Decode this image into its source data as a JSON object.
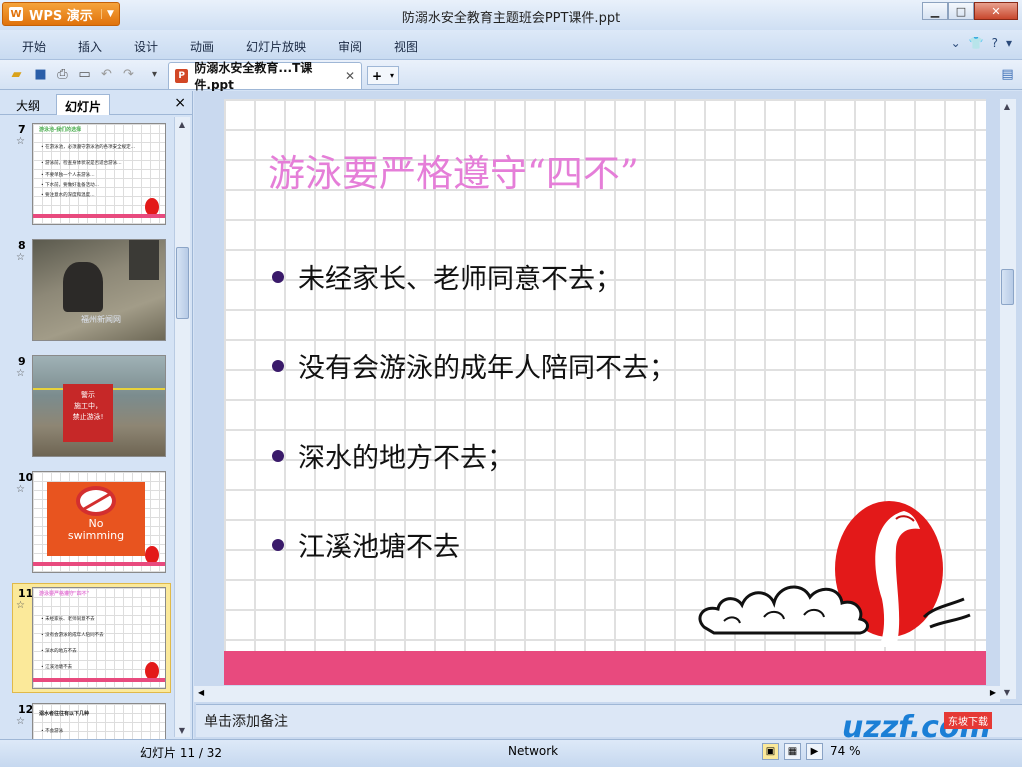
{
  "app": {
    "button_label": "WPS 演示",
    "window_title": "防溺水安全教育主题班会PPT课件.ppt"
  },
  "menus": [
    "开始",
    "插入",
    "设计",
    "动画",
    "幻灯片放映",
    "审阅",
    "视图"
  ],
  "document_tab": {
    "label": "防溺水安全教育...T课件.ppt"
  },
  "side_panel": {
    "tabs": [
      "大纲",
      "幻灯片"
    ],
    "close": "×"
  },
  "thumbnails": [
    {
      "number": "7",
      "title": "游泳池-我们的选择",
      "lines": [
        "• 在游泳池，必须遵守游泳池的各项安全规定…",
        "• 游泳前，检查身体状况是否适合游泳…",
        "• 不要单独一个人去游泳…",
        "• 下水前，要做好准备活动…",
        "• 要注意水的深度和温度…"
      ]
    },
    {
      "number": "8",
      "image": "photo-rescue",
      "overlay": "福州新闻网"
    },
    {
      "number": "9",
      "sign": [
        "警示",
        "施工中，",
        "禁止游泳!"
      ]
    },
    {
      "number": "10",
      "sign": [
        "No",
        "swimming"
      ]
    },
    {
      "number": "11",
      "title": "游泳要严格遵守\"四不\"",
      "lines": [
        "• 未经家长、老师同意不去",
        "• 没有会游泳的成年人陪同不去",
        "• 深水的地方不去",
        "• 江溪池塘不去"
      ],
      "selected": true
    },
    {
      "number": "12",
      "title": "溺水者往往有以下几种",
      "lines": [
        "• 不会游泳"
      ]
    }
  ],
  "slide": {
    "title": "游泳要严格遵守“四不”",
    "bullets": [
      "未经家长、老师同意不去；",
      "没有会游泳的成年人陪同不去；",
      "深水的地方不去；",
      "江溪池塘不去"
    ]
  },
  "notes_placeholder": "单击添加备注",
  "status": {
    "slide_counter": "幻灯片 11 / 32",
    "theme": "Network",
    "zoom": "74 %"
  },
  "watermark": {
    "text": "uzzf.com",
    "tag": "东坡下载"
  },
  "colors": {
    "title_pink": "#e57ed8",
    "band_pink": "#e84a7e",
    "logo_red": "#e31919",
    "bullet_dot": "#3a1a6a"
  }
}
